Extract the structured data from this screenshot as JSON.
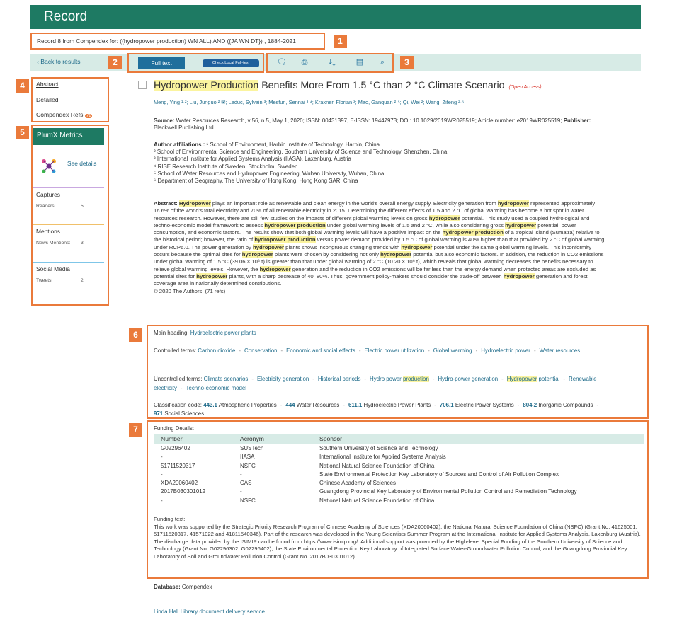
{
  "header": {
    "title": "Record"
  },
  "record": {
    "label": "Record 8 from Compendex for: ((hydropower production) WN ALL) AND ({JA WN DT}) , 1884-2021"
  },
  "toolbar": {
    "back": "Back to results",
    "full_text": "Full text",
    "check_local": "Check Local Full-text"
  },
  "callouts": [
    "1",
    "2",
    "3",
    "4",
    "5",
    "6",
    "7"
  ],
  "nav": {
    "abstract": "Abstract",
    "detailed": "Detailed",
    "compendex_refs": "Compendex Refs",
    "refs_count": "71"
  },
  "plumx": {
    "title": "PlumX Metrics",
    "see_details": "See details",
    "captures": "Captures",
    "readers_label": "Readers:",
    "readers": "5",
    "mentions": "Mentions",
    "news_label": "News Mentions:",
    "news": "3",
    "social": "Social Media",
    "tweets_label": "Tweets:",
    "tweets": "2"
  },
  "article": {
    "title_hl": "Hydropower Production",
    "title_rest": " Benefits More From 1.5 °C than 2 °C Climate Scenario",
    "open_access": "(Open Access)",
    "authors": "Meng, Ying ¹·²; Liu, Junguo ² ✉; Leduc, Sylvain ³; Mesfun, Sennai ³·⁴; Kraxner, Florian ³; Mao, Ganquan ²·⁵; Qi, Wei ²; Wang, Zifeng ²·⁶",
    "source_label": "Source:",
    "source": "Water Resources Research, v 56, n 5, May 1, 2020; ISSN: 00431397, E-ISSN: 19447973; DOI: 10.1029/2019WR025519; Article number: e2019WR025519;",
    "publisher_label": "Publisher:",
    "publisher": "Blackwell Publishing Ltd",
    "affil_label": "Author affiliations :",
    "affiliations": [
      "¹ School of Environment, Harbin Institute of Technology, Harbin, China",
      "² School of Environmental Science and Engineering, Southern University of Science and Technology, Shenzhen, China",
      "³ International Institute for Applied Systems Analysis (IIASA), Laxenburg, Austria",
      "⁴ RISE Research Institute of Sweden, Stockholm, Sweden",
      "⁵ School of Water Resources and Hydropower Engineering, Wuhan University, Wuhan, China",
      "⁶ Department of Geography, The University of Hong Kong, Hong Kong SAR, China"
    ],
    "abstract_label": "Abstract:",
    "abstract": "Hydropower plays an important role as renewable and clean energy in the world's overall energy supply. Electricity generation from hydropower represented approximately 16.6% of the world's total electricity and 70% of all renewable electricity in 2015. Determining the different effects of 1.5 and 2 °C of global warming has become a hot spot in water resources research. However, there are still few studies on the impacts of different global warming levels on gross hydropower potential. This study used a coupled hydrological and techno-economic model framework to assess hydropower production under global warming levels of 1.5 and 2 °C, while also considering gross hydropower potential, power consumption, and economic factors. The results show that both global warming levels will have a positive impact on the hydropower production of a tropical island (Sumatra) relative to the historical period; however, the ratio of hydropower production versus power demand provided by 1.5 °C of global warming is 40% higher than that provided by 2 °C of global warming under RCP6.0. The power generation by hydropower plants shows incongruous changing trends with hydropower potential under the same global warming levels. This inconformity occurs because the optimal sites for hydropower plants were chosen by considering not only hydropower potential but also economic factors. In addition, the reduction in CO2 emissions under global warming of 1.5 °C (39.06 × 10⁶ t) is greater than that under global warming of 2 °C (10.20 × 10⁶ t), which reveals that global warming decreases the benefits necessary to relieve global warming levels. However, the hydropower generation and the reduction in CO2 emissions will be far less than the energy demand when protected areas are excluded as potential sites for hydropower plants, with a sharp decrease of 40–80%. Thus, government policy-makers should consider the trade-off between hydropower generation and forest coverage area in nationally determined contributions.",
    "copyright": "© 2020 The Authors. (71 refs)"
  },
  "index": {
    "main_label": "Main heading:",
    "main": "Hydroelectric power plants",
    "controlled_label": "Controlled terms:",
    "controlled": [
      "Carbon dioxide",
      "Conservation",
      "Economic and social effects",
      "Electric power utilization",
      "Global warming",
      "Hydroelectric power",
      "Water resources"
    ],
    "uncontrolled_label": "Uncontrolled terms:",
    "uncontrolled": [
      "Climate scenarios",
      "Electricity generation",
      "Historical periods",
      "Hydro power production",
      "Hydro-power generation",
      "Hydropower potential",
      "Renewable electricity",
      "Techno-economic model"
    ],
    "class_label": "Classification code:",
    "classes": [
      [
        "443.1",
        "Atmospheric Properties"
      ],
      [
        "444",
        "Water Resources"
      ],
      [
        "611.1",
        "Hydroelectric Power Plants"
      ],
      [
        "706.1",
        "Electric Power Systems"
      ],
      [
        "804.2",
        "Inorganic Compounds"
      ],
      [
        "971",
        "Social Sciences"
      ]
    ]
  },
  "funding": {
    "label": "Funding Details:",
    "headers": [
      "Number",
      "Acronym",
      "Sponsor"
    ],
    "rows": [
      [
        "G02296402",
        "SUSTech",
        "Southern University of Science and Technology"
      ],
      [
        "-",
        "IIASA",
        "International Institute for Applied Systems Analysis"
      ],
      [
        "51711520317",
        "NSFC",
        "National Natural Science Foundation of China"
      ],
      [
        "-",
        "-",
        "State Environmental Protection Key Laboratory of Sources and Control of Air Pollution Complex"
      ],
      [
        "XDA20060402",
        "CAS",
        "Chinese Academy of Sciences"
      ],
      [
        "2017B030301012",
        "-",
        "Guangdong Provincial Key Laboratory of Environmental Pollution Control and Remediation Technology"
      ],
      [
        "-",
        "NSFC",
        "National Natural Science Foundation of China"
      ]
    ],
    "text_label": "Funding text:",
    "text": "This work was supported by the Strategic Priority Research Program of Chinese Academy of Sciences (XDA20060402), the National Natural Science Foundation of China (NSFC) (Grant No. 41625001, 51711520317, 41571022 and 41811540346). Part of the research was developed in the Young Scientists Summer Program at the International Institute for Applied Systems Analysis, Laxenburg (Austria). The discharge data provided by the ISIMIP can be found from https://www.isimip.org/. Additional support was provided by the High-level Special Funding of the Southern University of Science and Technology (Grant No. G02296302, G02296402), the State Environmental Protection Key Laboratory of Integrated Surface Water-Groundwater Pollution Control, and the Guangdong Provincial Key Laboratory of Soil and Groundwater Pollution Control (Grant No. 2017B030301012)."
  },
  "database": {
    "label": "Database:",
    "value": "Compendex"
  },
  "footer": {
    "link": "Linda Hall Library document delivery service"
  },
  "colors": {
    "header": "#1e7a63",
    "callout": "#ea7a3b",
    "link": "#1f6b8a",
    "highlight": "#fbf49f",
    "toolbar": "#d7ebe6"
  },
  "icons": [
    "comment-icon",
    "print-icon",
    "download-icon",
    "save-icon",
    "search-icon",
    "plumx-logo-icon",
    "envelope-icon",
    "chevron-left-icon",
    "checkbox-icon"
  ]
}
